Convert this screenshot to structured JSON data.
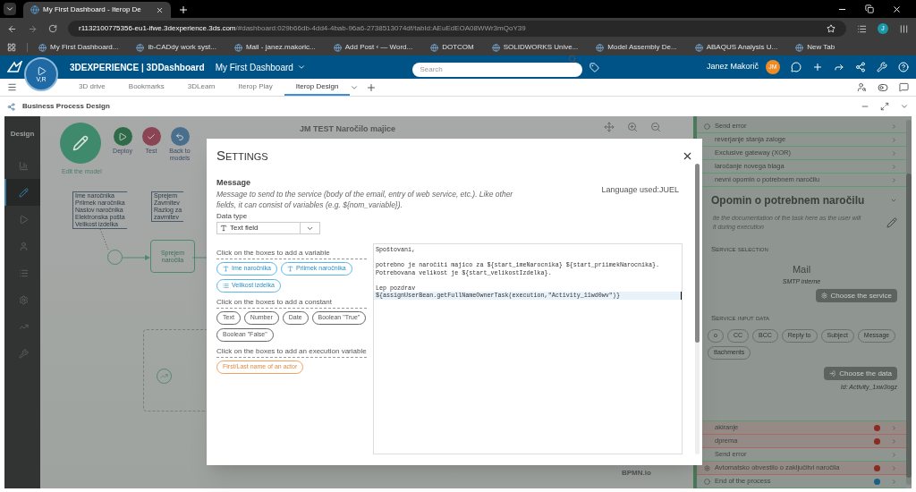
{
  "browser": {
    "tab_title": "My First Dashboard - Iterop De",
    "url_host": "r1132100775356-eu1-ifwe.3dexperience.3ds.com",
    "url_path": "/#dashboard:029b66db-4dd4-4bab-96a6-2738513074df/tabId:AEuEdEOA08WWr3mQoY39",
    "profile": "J",
    "bookmarks": [
      "My First Dashboard...",
      "ib-CADdy work syst...",
      "Mail - janez.makoric...",
      "Add Post ‹ — Word...",
      "DOTCOM",
      "SOLIDWORKS Unive...",
      "Model Assembly De...",
      "ABAQUS Analysis U...",
      "New Tab"
    ]
  },
  "header": {
    "brand": "3DEXPERIENCE | 3DDashboard",
    "compass_label": "V,R",
    "dashboard": "My First Dashboard",
    "search": {
      "placeholder": "Search"
    },
    "user": "Janez Makorič",
    "avatar": "JM"
  },
  "tabs": [
    {
      "label": "3D drive",
      "selected": false
    },
    {
      "label": "Bookmarks",
      "selected": false
    },
    {
      "label": "3DLearn",
      "selected": false
    },
    {
      "label": "Iterop Play",
      "selected": false
    },
    {
      "label": "Iterop Design",
      "selected": true
    }
  ],
  "widget": {
    "title": "Business Process Design"
  },
  "sidebar": {
    "title": "Design",
    "items": [
      {
        "kind": "chart",
        "selected": false
      },
      {
        "kind": "edit",
        "selected": true
      },
      {
        "kind": "play",
        "selected": false
      },
      {
        "kind": "user",
        "selected": false
      },
      {
        "kind": "list",
        "selected": false
      },
      {
        "kind": "gears",
        "selected": false
      },
      {
        "kind": "trend",
        "selected": false
      },
      {
        "kind": "wrench",
        "selected": false
      }
    ]
  },
  "canvas": {
    "title": "JM TEST Naročilo majice",
    "main_action": "Edit the model",
    "actions": [
      {
        "kind": "deploy",
        "label": "Deploy"
      },
      {
        "kind": "test",
        "label": "Test"
      },
      {
        "kind": "back",
        "label": "Back to models"
      }
    ],
    "annotations": [
      [
        "Ime naročnika",
        "Priimek naročnika",
        "Naslov naročnika",
        "Elektronska pošta",
        "Velikost izdelka"
      ],
      [
        "Sprejem",
        "Zavrnitev",
        "Razlog za",
        "zavrnitev"
      ]
    ],
    "task": "Sprejem naročila",
    "footer": "BPMN.io"
  },
  "dialog": {
    "title": "Settings",
    "field": "Message",
    "description": "Message to send to the service (body of the email, entry of web service, etc.). Like other fields, it can consist of variables (e.g. ${nom_variable}).",
    "language": "Language used:JUEL",
    "data_type": {
      "label": "Data type",
      "value": "Text field"
    },
    "groups": [
      {
        "heading": "Click on the boxes to add a variable",
        "kind": "variable",
        "chips": [
          {
            "label": "Ime naročnika",
            "kind": "text"
          },
          {
            "label": "Priimek naročnika",
            "kind": "text"
          },
          {
            "label": "Velikost izdelka",
            "kind": "list"
          }
        ]
      },
      {
        "heading": "Click on the boxes to add a constant",
        "kind": "constant",
        "chips": [
          {
            "label": "Text",
            "kind": "plain"
          },
          {
            "label": "Number",
            "kind": "plain"
          },
          {
            "label": "Date",
            "kind": "plain"
          },
          {
            "label": "Boolean \"True\"",
            "kind": "plain"
          },
          {
            "label": "Boolean \"False\"",
            "kind": "plain"
          }
        ]
      },
      {
        "heading": "Click on the boxes to add an execution variable",
        "kind": "execution",
        "chips": [
          {
            "label": "First/Last name of an actor",
            "kind": "plain"
          }
        ]
      }
    ],
    "paragraphs": [
      [
        {
          "text": "Spoštovani,",
          "active": false
        }
      ],
      [
        {
          "text": "potrebno je naročiti majico za ${start_imeNarocnika} ${start_priimekNarocnika}.",
          "active": false
        },
        {
          "text": "Potrebovana velikost je ${start_velikostIzdelka}.",
          "active": false
        }
      ],
      [
        {
          "text": "Lep pozdrav",
          "active": false
        },
        {
          "text": "${assignUserBean.getFullNameOwnerTask(execution,\"Activity_11wd0wv\")}",
          "active": true
        }
      ]
    ]
  },
  "panel": {
    "top_items": [
      {
        "label": "Send error",
        "kind": "event"
      },
      {
        "label": "reverjanje stanja zaloge",
        "kind": "plain"
      },
      {
        "label": "Exclusive gateway (XOR)",
        "kind": "plain"
      },
      {
        "label": "laročanje novega blaga",
        "kind": "plain"
      },
      {
        "label": "nevni opomin o potrebnem naročilu",
        "kind": "plain"
      }
    ],
    "title": "Opomin o potrebnem naročilu",
    "doc": [
      "ite the documentation of the task here as the user will",
      "it during execution"
    ],
    "service_heading": "Service selection",
    "service": "Mail",
    "service_sub": "SMTP interne",
    "service_button": "Choose the service",
    "input_heading": "Service input data",
    "inputs": [
      "o",
      "CC",
      "BCC",
      "Reply to",
      "Subject",
      "Message",
      "ttachments"
    ],
    "data_button": "Choose the data",
    "id": "Id: Activity_1xw3ogz",
    "bottom_items": [
      {
        "label": "akiranje",
        "kind": "plain",
        "color": "#8a2a22"
      },
      {
        "label": "dprema",
        "kind": "plain",
        "color": "#8a2a22"
      },
      {
        "label": "Send error",
        "kind": "plain"
      },
      {
        "label": "Avtomatsko obvestilo o zaključitvi naročila",
        "kind": "gear",
        "color": "#8a2a22"
      },
      {
        "label": "End of the process",
        "kind": "end",
        "color": "#1d5f80"
      }
    ]
  }
}
